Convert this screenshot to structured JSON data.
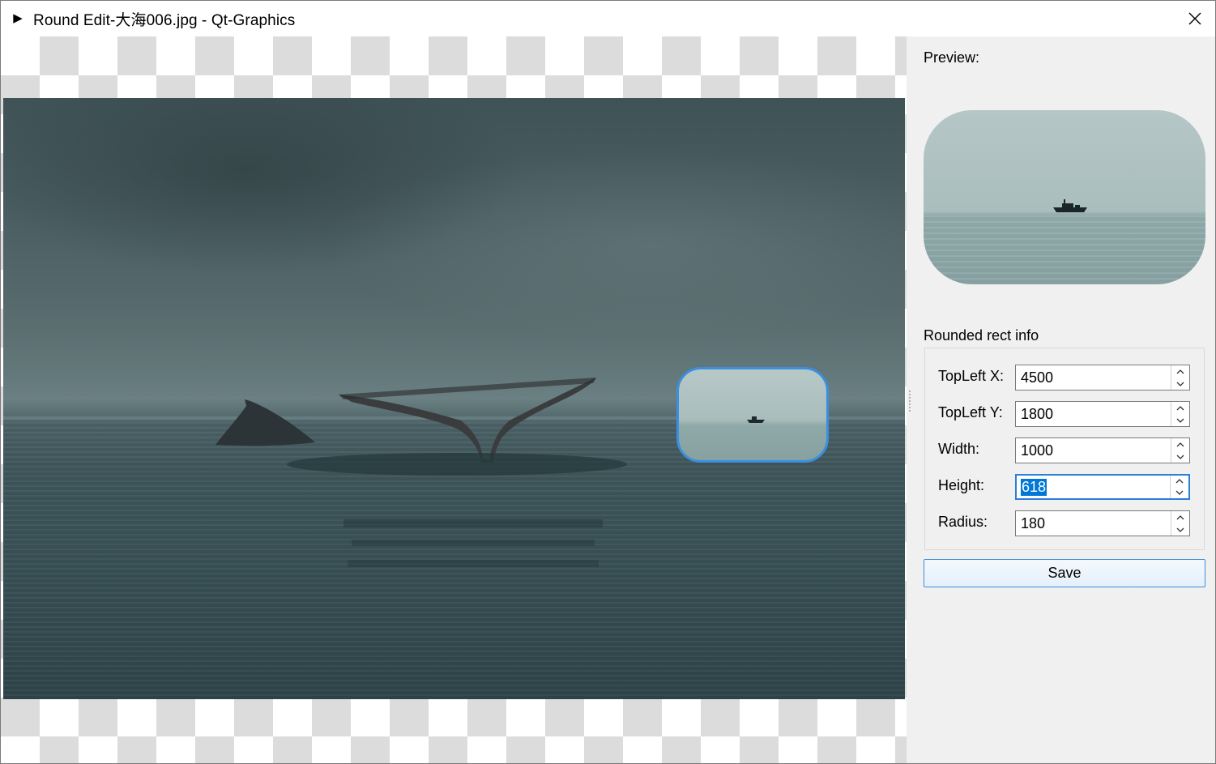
{
  "window": {
    "title": "Round Edit-大海006.jpg - Qt-Graphics",
    "app_icon": "play-triangle-icon",
    "close_icon": "close-icon"
  },
  "panel": {
    "preview_label": "Preview:",
    "group_title": "Rounded rect info",
    "fields": [
      {
        "label": "TopLeft X:",
        "value": "4500"
      },
      {
        "label": "TopLeft Y:",
        "value": "1800"
      },
      {
        "label": "Width:",
        "value": "1000"
      },
      {
        "label": "Height:",
        "value": "618"
      },
      {
        "label": "Radius:",
        "value": "180"
      }
    ],
    "focused_field": "Height:",
    "save_label": "Save"
  },
  "colors": {
    "selection_accent": "#3b8fe0",
    "text_selection": "#0078d7",
    "checker": "#dcdcdc",
    "panel_bg": "#f0f0f0"
  }
}
